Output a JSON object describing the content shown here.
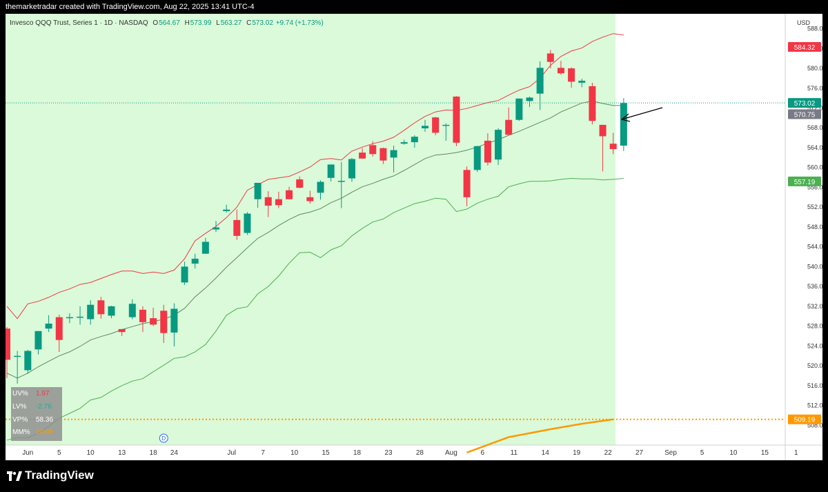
{
  "topbar": {
    "text": "themarketradar created with TradingView.com, Aug 22, 2025 13:41 UTC-4"
  },
  "header": {
    "symbol": "Invesco QQQ Trust, Series 1 · 1D · NASDAQ",
    "o_label": "O",
    "o": "564.67",
    "h_label": "H",
    "h": "573.99",
    "l_label": "L",
    "l": "563.27",
    "c_label": "C",
    "c": "573.02",
    "chg": "+9.74 (+1.73%)"
  },
  "currency": "USD",
  "indicators": [
    {
      "label": "UV%",
      "value": "1.97",
      "color": "#f23645"
    },
    {
      "label": "LV%",
      "value": "-2.76",
      "color": "#22ab94"
    },
    {
      "label": "VP%",
      "value": "58.36",
      "color": "#ffffff"
    },
    {
      "label": "MM%",
      "value": "10.08",
      "color": "#ff9800"
    }
  ],
  "brand": "TradingView",
  "chart_data": {
    "type": "candlestick",
    "y_range": [
      504,
      591
    ],
    "y_ticks": [
      508,
      512,
      516,
      520,
      524,
      528,
      532,
      536,
      540,
      544,
      548,
      552,
      556,
      560,
      564,
      568,
      572,
      576,
      580,
      584,
      588
    ],
    "x_ticks": [
      {
        "i": 2,
        "label": "Jun"
      },
      {
        "i": 5,
        "label": "5"
      },
      {
        "i": 8,
        "label": "10"
      },
      {
        "i": 11,
        "label": "13"
      },
      {
        "i": 14,
        "label": "18"
      },
      {
        "i": 16,
        "label": "24"
      },
      {
        "i": 21.5,
        "label": "Jul"
      },
      {
        "i": 24.5,
        "label": "7"
      },
      {
        "i": 27.5,
        "label": "10"
      },
      {
        "i": 30.5,
        "label": "15"
      },
      {
        "i": 33.5,
        "label": "18"
      },
      {
        "i": 36.5,
        "label": "23"
      },
      {
        "i": 39.5,
        "label": "28"
      },
      {
        "i": 42.5,
        "label": "Aug"
      },
      {
        "i": 45.5,
        "label": "6"
      },
      {
        "i": 48.5,
        "label": "11"
      },
      {
        "i": 51.5,
        "label": "14"
      },
      {
        "i": 54.5,
        "label": "19"
      },
      {
        "i": 57.5,
        "label": "22"
      },
      {
        "i": 60.5,
        "label": "27"
      },
      {
        "i": 63.5,
        "label": "Sep"
      },
      {
        "i": 66.5,
        "label": "5"
      },
      {
        "i": 69.5,
        "label": "10"
      },
      {
        "i": 72.5,
        "label": "15"
      },
      {
        "i": 75.5,
        "label": "1"
      }
    ],
    "candles": [
      {
        "o": 527.5,
        "h": 527.8,
        "l": 517.5,
        "c": 521.2
      },
      {
        "o": 521.8,
        "h": 523.0,
        "l": 516.4,
        "c": 522.0
      },
      {
        "o": 519.1,
        "h": 523.2,
        "l": 518.4,
        "c": 523.0
      },
      {
        "o": 523.3,
        "h": 527.0,
        "l": 522.3,
        "c": 527.0
      },
      {
        "o": 527.5,
        "h": 530.2,
        "l": 526.8,
        "c": 528.5
      },
      {
        "o": 529.8,
        "h": 530.3,
        "l": 522.8,
        "c": 525.2
      },
      {
        "o": 529.8,
        "h": 530.6,
        "l": 528.6,
        "c": 529.8
      },
      {
        "o": 529.8,
        "h": 532.0,
        "l": 528.3,
        "c": 529.9
      },
      {
        "o": 529.4,
        "h": 533.2,
        "l": 528.3,
        "c": 532.3
      },
      {
        "o": 533.2,
        "h": 533.9,
        "l": 529.5,
        "c": 530.4
      },
      {
        "o": 530.1,
        "h": 532.1,
        "l": 529.6,
        "c": 532.0
      },
      {
        "o": 527.4,
        "h": 527.4,
        "l": 526.0,
        "c": 526.8
      },
      {
        "o": 529.8,
        "h": 533.4,
        "l": 529.4,
        "c": 532.5
      },
      {
        "o": 531.3,
        "h": 532.0,
        "l": 526.8,
        "c": 528.8
      },
      {
        "o": 529.6,
        "h": 531.7,
        "l": 528.0,
        "c": 528.3
      },
      {
        "o": 531.1,
        "h": 532.3,
        "l": 524.6,
        "c": 526.6
      },
      {
        "o": 526.7,
        "h": 532.6,
        "l": 523.9,
        "c": 531.5
      },
      {
        "o": 536.8,
        "h": 541.0,
        "l": 536.3,
        "c": 540.0
      },
      {
        "o": 540.6,
        "h": 542.6,
        "l": 539.6,
        "c": 541.6
      },
      {
        "o": 542.6,
        "h": 545.8,
        "l": 542.6,
        "c": 545.0
      },
      {
        "o": 547.5,
        "h": 549.2,
        "l": 547.0,
        "c": 547.9
      },
      {
        "o": 551.2,
        "h": 552.5,
        "l": 550.9,
        "c": 551.5
      },
      {
        "o": 549.4,
        "h": 551.5,
        "l": 545.4,
        "c": 546.2
      },
      {
        "o": 546.8,
        "h": 551.0,
        "l": 546.4,
        "c": 550.7
      },
      {
        "o": 553.6,
        "h": 556.9,
        "l": 551.9,
        "c": 556.9
      },
      {
        "o": 554.0,
        "h": 555.2,
        "l": 550.0,
        "c": 552.3
      },
      {
        "o": 553.6,
        "h": 555.1,
        "l": 551.8,
        "c": 552.4
      },
      {
        "o": 555.4,
        "h": 556.1,
        "l": 553.6,
        "c": 553.6
      },
      {
        "o": 557.6,
        "h": 558.2,
        "l": 555.8,
        "c": 555.9
      },
      {
        "o": 554.0,
        "h": 555.3,
        "l": 552.7,
        "c": 553.2
      },
      {
        "o": 554.9,
        "h": 557.4,
        "l": 553.5,
        "c": 557.1
      },
      {
        "o": 557.9,
        "h": 560.5,
        "l": 557.2,
        "c": 560.6
      },
      {
        "o": 557.3,
        "h": 561.1,
        "l": 551.8,
        "c": 557.3
      },
      {
        "o": 557.8,
        "h": 561.9,
        "l": 557.1,
        "c": 561.7
      },
      {
        "o": 563.0,
        "h": 563.9,
        "l": 561.8,
        "c": 561.8
      },
      {
        "o": 564.5,
        "h": 565.3,
        "l": 562.2,
        "c": 562.7
      },
      {
        "o": 563.9,
        "h": 564.0,
        "l": 560.7,
        "c": 561.4
      },
      {
        "o": 562.0,
        "h": 564.4,
        "l": 559.0,
        "c": 563.5
      },
      {
        "o": 564.8,
        "h": 565.6,
        "l": 564.6,
        "c": 565.1
      },
      {
        "o": 565.1,
        "h": 566.5,
        "l": 564.0,
        "c": 566.2
      },
      {
        "o": 567.9,
        "h": 569.6,
        "l": 567.2,
        "c": 568.4
      },
      {
        "o": 570.1,
        "h": 570.2,
        "l": 566.5,
        "c": 567.0
      },
      {
        "o": 568.4,
        "h": 568.9,
        "l": 565.4,
        "c": 568.6
      },
      {
        "o": 574.3,
        "h": 574.4,
        "l": 564.3,
        "c": 565.0
      },
      {
        "o": 559.5,
        "h": 560.2,
        "l": 552.2,
        "c": 554.0
      },
      {
        "o": 559.5,
        "h": 564.4,
        "l": 559.1,
        "c": 564.3
      },
      {
        "o": 565.4,
        "h": 566.9,
        "l": 560.4,
        "c": 561.0
      },
      {
        "o": 561.6,
        "h": 567.9,
        "l": 560.5,
        "c": 567.6
      },
      {
        "o": 569.6,
        "h": 572.1,
        "l": 566.6,
        "c": 566.6
      },
      {
        "o": 569.6,
        "h": 573.9,
        "l": 569.4,
        "c": 573.9
      },
      {
        "o": 573.4,
        "h": 574.3,
        "l": 572.2,
        "c": 574.1
      },
      {
        "o": 574.9,
        "h": 581.4,
        "l": 571.6,
        "c": 580.1
      },
      {
        "o": 583.0,
        "h": 583.7,
        "l": 580.0,
        "c": 581.3
      },
      {
        "o": 580.1,
        "h": 581.5,
        "l": 578.7,
        "c": 579.0
      },
      {
        "o": 580.0,
        "h": 580.2,
        "l": 576.1,
        "c": 577.3
      },
      {
        "o": 577.1,
        "h": 577.9,
        "l": 576.2,
        "c": 577.5
      },
      {
        "o": 576.4,
        "h": 577.1,
        "l": 568.7,
        "c": 569.4
      },
      {
        "o": 568.6,
        "h": 568.6,
        "l": 559.2,
        "c": 566.3
      },
      {
        "o": 564.8,
        "h": 567.0,
        "l": 562.7,
        "c": 563.7
      },
      {
        "o": 564.4,
        "h": 574.0,
        "l": 563.3,
        "c": 573.0
      }
    ],
    "upper_band": [
      532,
      529.5,
      532.5,
      533,
      533.8,
      534.8,
      535.5,
      536.4,
      536.8,
      537.6,
      538.4,
      539.1,
      539.1,
      538.6,
      538.9,
      538.6,
      539.3,
      541.6,
      545.2,
      546.7,
      548.1,
      549.9,
      552,
      555.4,
      556.5,
      557.6,
      557.9,
      558.2,
      559.1,
      560.1,
      561.6,
      561.8,
      561.5,
      563.3,
      564.1,
      564.8,
      565.3,
      566.1,
      567.5,
      569,
      570.3,
      571.2,
      571.6,
      571.5,
      571.9,
      572.5,
      573.1,
      573.5,
      574.6,
      575.6,
      576.3,
      578,
      580.6,
      582.4,
      583.5,
      584.1,
      585.4,
      586.3,
      587,
      586.7
    ],
    "middle_band": [
      518.5,
      517.5,
      518.5,
      519.8,
      520.9,
      522,
      522.8,
      523.9,
      525.2,
      525.9,
      526.5,
      527.3,
      527.9,
      528.5,
      528.9,
      529.4,
      530.2,
      531.6,
      533.9,
      535.7,
      537.7,
      539.9,
      541.8,
      543.8,
      545.7,
      546.9,
      548.3,
      549.5,
      550.5,
      551,
      551.7,
      552.9,
      553.8,
      555,
      556.1,
      556.8,
      557.6,
      558.3,
      559.4,
      560.6,
      561.8,
      562.5,
      562.7,
      563,
      563.5,
      564.1,
      564.9,
      565.6,
      566.5,
      567.3,
      568.2,
      569.1,
      570,
      571.2,
      572.1,
      573,
      573.4,
      572.9,
      572.5,
      572.5
    ],
    "lower_band": [
      505,
      505.5,
      505.5,
      506.4,
      507.8,
      509.4,
      510.4,
      511.4,
      513.1,
      513.6,
      514.9,
      516,
      516.9,
      517.4,
      518.8,
      520.1,
      521.5,
      521.8,
      522.8,
      524.3,
      527,
      530.2,
      531.5,
      531.9,
      534.5,
      536,
      538.1,
      540.7,
      542.8,
      542.9,
      541.8,
      543.4,
      544.2,
      546.2,
      547.7,
      549,
      549.6,
      550.9,
      551.8,
      552.7,
      553.2,
      553.8,
      553.6,
      551.1,
      551.6,
      552.8,
      553.6,
      554.2,
      556.1,
      556.7,
      557.2,
      557.2,
      557.3,
      557.6,
      557.8,
      557.7,
      557.7,
      557.5,
      557.6,
      557.8
    ],
    "ma_orange": [
      [
        44,
        502.5
      ],
      [
        48,
        505.6
      ],
      [
        52,
        507.2
      ],
      [
        55,
        508.3
      ],
      [
        58,
        509.19
      ]
    ],
    "price_labels": [
      {
        "value": "584.32",
        "y": 584.32,
        "color": "#f23645"
      },
      {
        "value": "573.02",
        "y": 573.02,
        "color": "#089981"
      },
      {
        "value": "570.75",
        "y": 570.75,
        "color": "#787b86"
      },
      {
        "value": "557.19",
        "y": 557.19,
        "color": "#4caf50"
      },
      {
        "value": "509.19",
        "y": 509.19,
        "color": "#ff9800"
      }
    ],
    "last_price_line": 573.02,
    "dotted_level": 509.19,
    "dividend_marker": {
      "label": "D",
      "i": 15
    }
  },
  "colors": {
    "up": "#089981",
    "down": "#f23645",
    "bg": "#dafad9"
  }
}
